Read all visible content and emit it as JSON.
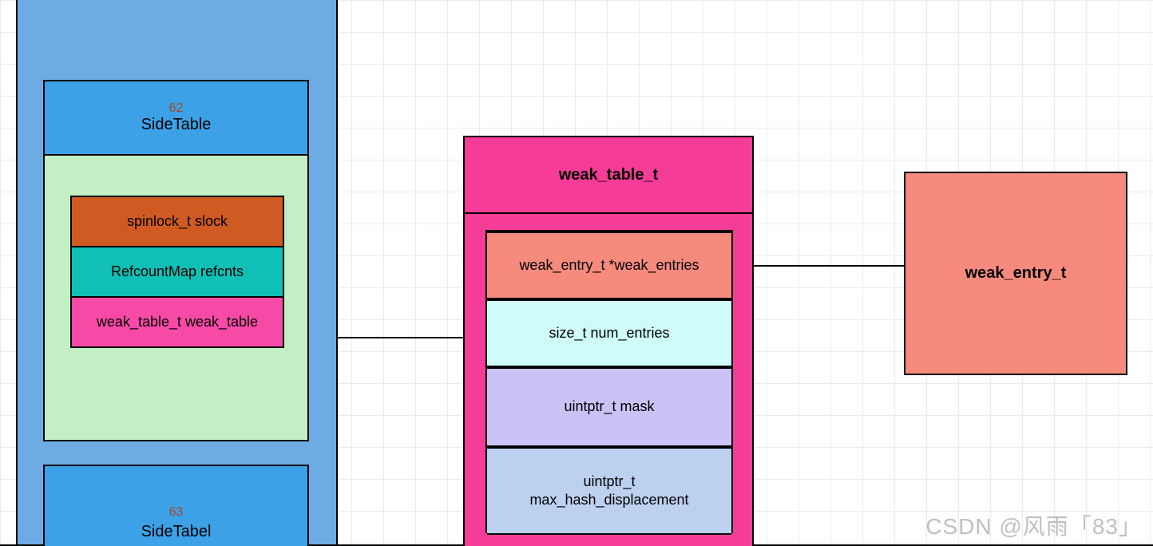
{
  "left_column": {
    "sidetable_62": {
      "num": "62",
      "title": "SideTable"
    },
    "fields": {
      "slock": "spinlock_t slock",
      "refcnts": "RefcountMap refcnts",
      "wtable": "weak_table_t weak_table"
    },
    "sidetable_63": {
      "num": "63",
      "title": "SideTabel"
    }
  },
  "weak_table": {
    "title": "weak_table_t",
    "fields": {
      "entries": "weak_entry_t *weak_entries",
      "num_entries": "size_t    num_entries",
      "mask": "uintptr_t mask",
      "max_hash": "uintptr_t\nmax_hash_displacement"
    }
  },
  "weak_entry": {
    "title": "weak_entry_t"
  },
  "watermark": "CSDN @风雨「83」"
}
